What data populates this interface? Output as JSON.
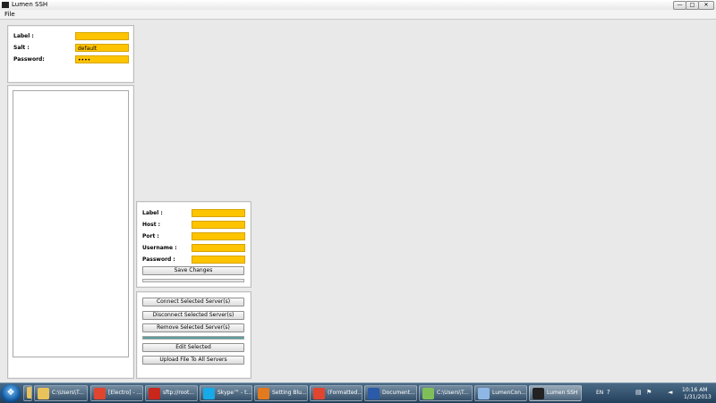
{
  "window": {
    "title": "Lumen SSH",
    "minimize_glyph": "—",
    "maximize_glyph": "□",
    "close_glyph": "✕"
  },
  "menu": {
    "file": "File"
  },
  "config": {
    "label_lbl": "Label :",
    "label_value": "",
    "salt_lbl": "Salt :",
    "salt_value": "default",
    "password_lbl": "Password:",
    "password_value": "••••"
  },
  "servers_list": {
    "items": []
  },
  "server_form": {
    "label_lbl": "Label :",
    "host_lbl": "Host :",
    "port_lbl": "Port :",
    "username_lbl": "Username :",
    "password_lbl": "Password :",
    "label_value": "",
    "host_value": "",
    "port_value": "",
    "username_value": "",
    "password_value": "",
    "save_label": "Save Changes",
    "progress": 0
  },
  "actions": {
    "connect": "Connect Selected Server(s)",
    "disconnect": "Disconnect Selected Server(s)",
    "remove": "Remove Selected Server(s)",
    "edit": "Edit Selected",
    "upload": "Upload File To All Servers",
    "progress": 1
  },
  "taskbar": {
    "start_glyph": "❖",
    "items": [
      {
        "label": "",
        "icon": "folder-icon",
        "color": "#e8c25a"
      },
      {
        "label": "C:\\Users\\T...",
        "icon": "folder-icon",
        "color": "#e8c25a"
      },
      {
        "label": "[Electro] - ...",
        "icon": "chrome-icon",
        "color": "#e0452f"
      },
      {
        "label": "sftp://root...",
        "icon": "filezilla-icon",
        "color": "#c9261c"
      },
      {
        "label": "Skype™ - t...",
        "icon": "skype-icon",
        "color": "#18a9e8"
      },
      {
        "label": "Setting Blu...",
        "icon": "firefox-icon",
        "color": "#e27a1f"
      },
      {
        "label": "(Formatted...",
        "icon": "chrome-icon",
        "color": "#e0452f"
      },
      {
        "label": "Document...",
        "icon": "word-icon",
        "color": "#2a5aa8"
      },
      {
        "label": "C:\\Users\\T...",
        "icon": "notepad-icon",
        "color": "#7fbf5a"
      },
      {
        "label": "LumenCon...",
        "icon": "cube-icon",
        "color": "#8fb7e6"
      },
      {
        "label": "Lumen SSH",
        "icon": "console-icon",
        "color": "#222222"
      }
    ],
    "tray": {
      "lang": "EN",
      "time": "10:16 AM",
      "date": "1/31/2013"
    }
  }
}
